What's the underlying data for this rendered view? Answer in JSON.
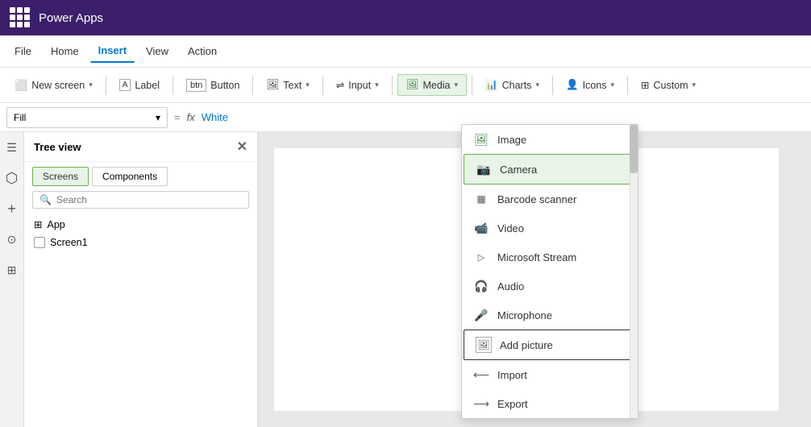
{
  "titleBar": {
    "appName": "Power Apps"
  },
  "menuBar": {
    "items": [
      {
        "id": "file",
        "label": "File"
      },
      {
        "id": "home",
        "label": "Home"
      },
      {
        "id": "insert",
        "label": "Insert",
        "active": true
      },
      {
        "id": "view",
        "label": "View"
      },
      {
        "id": "action",
        "label": "Action"
      }
    ]
  },
  "toolbar": {
    "newScreen": "New screen",
    "label": "Label",
    "button": "Button",
    "text": "Text",
    "input": "Input",
    "media": "Media",
    "charts": "Charts",
    "icons": "Icons",
    "custom": "Custom"
  },
  "formulaBar": {
    "fillLabel": "Fill",
    "fxSymbol": "fx",
    "equalsSign": "=",
    "value": "White"
  },
  "treeView": {
    "title": "Tree view",
    "tabs": [
      {
        "id": "screens",
        "label": "Screens",
        "active": true
      },
      {
        "id": "components",
        "label": "Components"
      }
    ],
    "searchPlaceholder": "Search",
    "items": [
      {
        "id": "app",
        "label": "App",
        "type": "app"
      },
      {
        "id": "screen1",
        "label": "Screen1",
        "type": "screen"
      }
    ]
  },
  "mediaDropdown": {
    "items": [
      {
        "id": "image",
        "label": "Image",
        "icon": "image"
      },
      {
        "id": "camera",
        "label": "Camera",
        "icon": "camera",
        "highlighted": true
      },
      {
        "id": "barcode",
        "label": "Barcode scanner",
        "icon": "barcode"
      },
      {
        "id": "video",
        "label": "Video",
        "icon": "video"
      },
      {
        "id": "stream",
        "label": "Microsoft Stream",
        "icon": "stream"
      },
      {
        "id": "audio",
        "label": "Audio",
        "icon": "audio"
      },
      {
        "id": "microphone",
        "label": "Microphone",
        "icon": "microphone"
      },
      {
        "id": "addpicture",
        "label": "Add picture",
        "icon": "addpicture",
        "outlined": true
      },
      {
        "id": "import",
        "label": "Import",
        "icon": "import"
      },
      {
        "id": "export",
        "label": "Export",
        "icon": "export"
      }
    ]
  },
  "leftSidebar": {
    "icons": [
      {
        "id": "menu",
        "symbol": "☰"
      },
      {
        "id": "layers",
        "symbol": "⬡"
      },
      {
        "id": "plus",
        "symbol": "+"
      },
      {
        "id": "data",
        "symbol": "⊙"
      },
      {
        "id": "components2",
        "symbol": "⊞"
      }
    ]
  }
}
